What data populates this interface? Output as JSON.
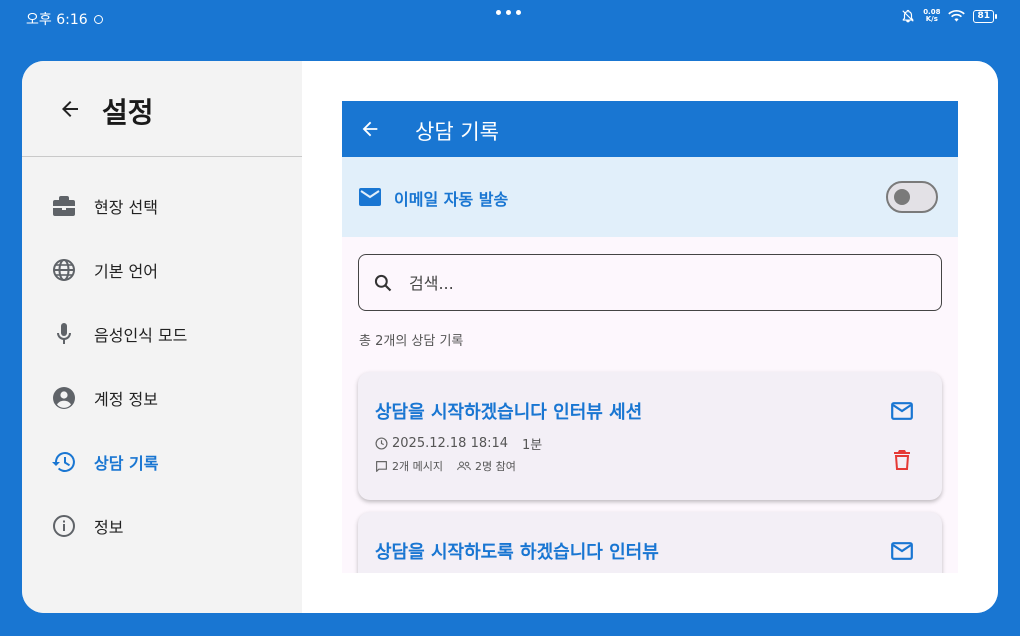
{
  "statusbar": {
    "time": "오후 6:16",
    "net_speed_value": "0.08",
    "net_speed_unit": "K/s",
    "battery": "81"
  },
  "sidebar": {
    "title": "설정",
    "items": [
      {
        "label": "현장 선택",
        "icon": "briefcase-icon"
      },
      {
        "label": "기본 언어",
        "icon": "globe-icon"
      },
      {
        "label": "음성인식 모드",
        "icon": "microphone-icon"
      },
      {
        "label": "계정 정보",
        "icon": "account-circle-icon"
      },
      {
        "label": "상담 기록",
        "icon": "history-icon",
        "active": true
      },
      {
        "label": "정보",
        "icon": "info-icon"
      }
    ]
  },
  "panel": {
    "title": "상담 기록",
    "email_auto_send_label": "이메일 자동 발송",
    "email_auto_send_on": false,
    "search": {
      "placeholder": "검색...",
      "value": ""
    },
    "count_text": "총 2개의 상담 기록",
    "records": [
      {
        "title": "상담을 시작하겠습니다 인터뷰 세션",
        "datetime": "2025.12.18 18:14",
        "duration": "1분",
        "messages": "2개 메시지",
        "participants": "2명 참여"
      },
      {
        "title": "상담을 시작하도록 하겠습니다 인터뷰"
      }
    ]
  },
  "colors": {
    "accent": "#1976d2",
    "delete": "#e53935",
    "background": "#1976d2"
  }
}
